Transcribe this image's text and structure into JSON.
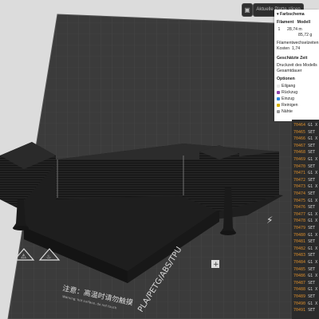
{
  "toolbar": {
    "button_label": "Aktuelle Platte slicen",
    "icon": "slice-icon"
  },
  "panel": {
    "title": "Farbschema",
    "col_filament": "Filament",
    "col_model": "Modell",
    "filament_index": "1",
    "length": "28,74 m",
    "weight": "85,72 g",
    "wechsel_label": "Filamentwechselzeiten",
    "kosten_label": "Kosten",
    "kosten_value": "1,74",
    "zeit_header": "Geschätzte Zeit",
    "druckzeit": "Druckzeit des Modells",
    "gesamtdauer": "Gesamtdauer",
    "optionen_header": "Optionen",
    "options": [
      {
        "label": "Eilgang",
        "color": "#e8e8e8"
      },
      {
        "label": "Rückzug",
        "color": "#8e44ad"
      },
      {
        "label": "Einzug",
        "color": "#2e86de"
      },
      {
        "label": "Reinigen",
        "color": "#d4b106"
      },
      {
        "label": "Nähte",
        "color": "#9a9a9a"
      }
    ]
  },
  "gcode": {
    "lines": [
      {
        "n": "70464",
        "c": "G1 X"
      },
      {
        "n": "70465",
        "c": "SET"
      },
      {
        "n": "70466",
        "c": "G1 X"
      },
      {
        "n": "70467",
        "c": "SET"
      },
      {
        "n": "70468",
        "c": "SET"
      },
      {
        "n": "70469",
        "c": "G1 X"
      },
      {
        "n": "70470",
        "c": "SET"
      },
      {
        "n": "70471",
        "c": "G1 X"
      },
      {
        "n": "70472",
        "c": "SET"
      },
      {
        "n": "70473",
        "c": "G1 X"
      },
      {
        "n": "70474",
        "c": "SET"
      },
      {
        "n": "70475",
        "c": "G1 X"
      },
      {
        "n": "70476",
        "c": "SET"
      },
      {
        "n": "70477",
        "c": "G1 X"
      },
      {
        "n": "70478",
        "c": "G1 X"
      },
      {
        "n": "70479",
        "c": "SET"
      },
      {
        "n": "70480",
        "c": "G1 X"
      },
      {
        "n": "70481",
        "c": "SET"
      },
      {
        "n": "70482",
        "c": "G1 X"
      },
      {
        "n": "70483",
        "c": "SET"
      },
      {
        "n": "70484",
        "c": "G1 X"
      },
      {
        "n": "70485",
        "c": "SET"
      },
      {
        "n": "70486",
        "c": "G1 X"
      },
      {
        "n": "70487",
        "c": "SET"
      },
      {
        "n": "70488",
        "c": "G1 X"
      },
      {
        "n": "70489",
        "c": "SET"
      },
      {
        "n": "70490",
        "c": "G1 X"
      },
      {
        "n": "70491",
        "c": "SET"
      }
    ]
  },
  "bed": {
    "label_material": "PLA/PETG/ABS/TPU",
    "label_warning_cn": "注意：高温时请勿触摸",
    "label_warning_en": "Warning: hot surface, do not touch"
  },
  "colors": {
    "background": "#dcdcdc",
    "bed": "#3a3a3a",
    "model": "#1f1f1f",
    "gcode_number": "#d98c2b"
  }
}
